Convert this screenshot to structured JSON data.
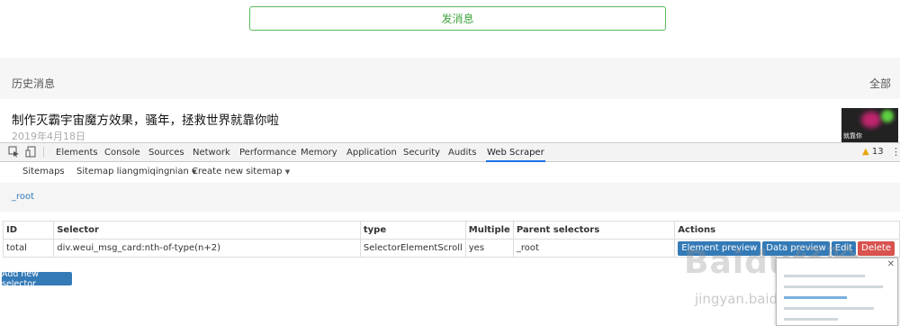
{
  "page": {
    "send_button": "发消息",
    "history_title": "历史消息",
    "history_all": "全部",
    "message": {
      "title": "制作灭霸宇宙魔方效果，骚年，拯救世界就靠你啦",
      "date": "2019年4月18日",
      "thumb_caption": "就靠你"
    }
  },
  "devtools": {
    "tabs": [
      "Elements",
      "Console",
      "Sources",
      "Network",
      "Performance",
      "Memory",
      "Application",
      "Security",
      "Audits",
      "Web Scraper"
    ],
    "active_tab": "Web Scraper",
    "warnings": "13",
    "icons": [
      "inspect-icon",
      "device-toggle-icon",
      "warning-icon",
      "more-vertical-icon"
    ]
  },
  "scraper": {
    "nav": {
      "sitemaps": "Sitemaps",
      "sitemap": "Sitemap liangmiqingnian",
      "create": "Create new sitemap"
    },
    "breadcrumb": "_root",
    "table": {
      "headers": [
        "ID",
        "Selector",
        "type",
        "Multiple",
        "Parent selectors",
        "Actions"
      ],
      "rows": [
        {
          "id": "total",
          "selector": "div.weui_msg_card:nth-of-type(n+2)",
          "type": "SelectorElementScroll",
          "multiple": "yes",
          "parent": "_root",
          "actions": [
            "Element preview",
            "Data preview",
            "Edit",
            "Delete"
          ]
        }
      ]
    },
    "add_selector": "Add new selector"
  },
  "watermark": {
    "logo": "Baidu经验",
    "url": "jingyan.baidu.com"
  },
  "colors": {
    "send_green": "#3ea43e",
    "link_blue": "#337ab7",
    "danger_red": "#d9534f",
    "active_tab_blue": "#1a73e8",
    "warning_yellow": "#e8a60c"
  }
}
